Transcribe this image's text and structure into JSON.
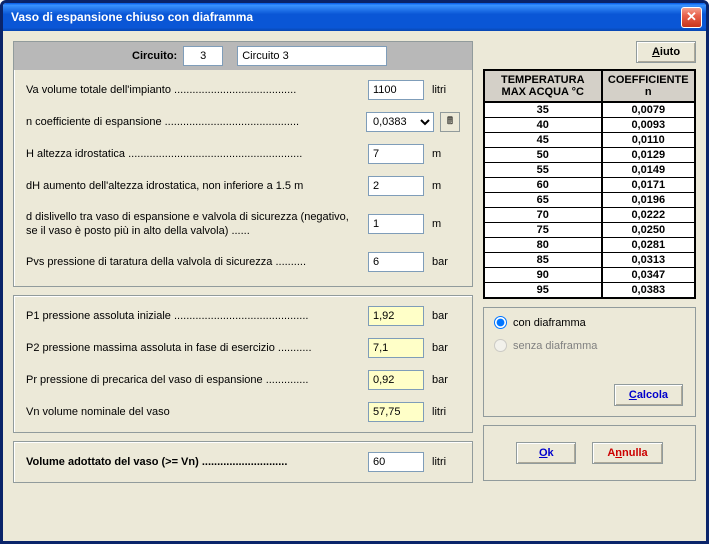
{
  "title": "Vaso di espansione chiuso con diaframma",
  "circuit": {
    "label": "Circuito:",
    "num": "3",
    "name": "Circuito 3"
  },
  "help_label": "Aiuto",
  "inputs": {
    "va": {
      "label": "Va  volume totale dell'impianto ........................................",
      "value": "1100",
      "unit": "litri"
    },
    "n": {
      "label": "n  coefficiente di espansione ............................................",
      "value": "0,0383",
      "unit": ""
    },
    "h": {
      "label": "H  altezza idrostatica .........................................................",
      "value": "7",
      "unit": "m"
    },
    "dh": {
      "label": "dH  aumento dell'altezza idrostatica, non inferiore a 1.5 m",
      "value": "2",
      "unit": "m"
    },
    "d": {
      "label": "d  dislivello tra vaso di espansione e valvola di sicurezza (negativo, se il vaso è posto più in alto della valvola) ......",
      "value": "1",
      "unit": "m"
    },
    "pvs": {
      "label": "Pvs   pressione di taratura della valvola di sicurezza ..........",
      "value": "6",
      "unit": "bar"
    }
  },
  "outputs": {
    "p1": {
      "label": "P1  pressione assoluta iniziale ............................................",
      "value": "1,92",
      "unit": "bar"
    },
    "p2": {
      "label": "P2  pressione massima assoluta in fase di esercizio ...........",
      "value": "7,1",
      "unit": "bar"
    },
    "pr": {
      "label": "Pr  pressione di precarica del vaso di espansione ..............",
      "value": "0,92",
      "unit": "bar"
    },
    "vn": {
      "label": "Vn  volume nominale del vaso",
      "value": "57,75",
      "unit": "litri"
    }
  },
  "final": {
    "label": "Volume adottato del vaso (>= Vn) ............................",
    "value": "60",
    "unit": "litri"
  },
  "table": {
    "h1": "TEMPERATURA MAX ACQUA °C",
    "h2": "COEFFICIENTE n",
    "rows": [
      {
        "t": "35",
        "c": "0,0079"
      },
      {
        "t": "40",
        "c": "0,0093"
      },
      {
        "t": "45",
        "c": "0,0110"
      },
      {
        "t": "50",
        "c": "0,0129"
      },
      {
        "t": "55",
        "c": "0,0149"
      },
      {
        "t": "60",
        "c": "0,0171"
      },
      {
        "t": "65",
        "c": "0,0196"
      },
      {
        "t": "70",
        "c": "0,0222"
      },
      {
        "t": "75",
        "c": "0,0250"
      },
      {
        "t": "80",
        "c": "0,0281"
      },
      {
        "t": "85",
        "c": "0,0313"
      },
      {
        "t": "90",
        "c": "0,0347"
      },
      {
        "t": "95",
        "c": "0,0383"
      }
    ]
  },
  "radio": {
    "with": "con diaframma",
    "without": "senza diaframma"
  },
  "buttons": {
    "calc": "Calcola",
    "ok": "Ok",
    "cancel": "Annulla"
  }
}
